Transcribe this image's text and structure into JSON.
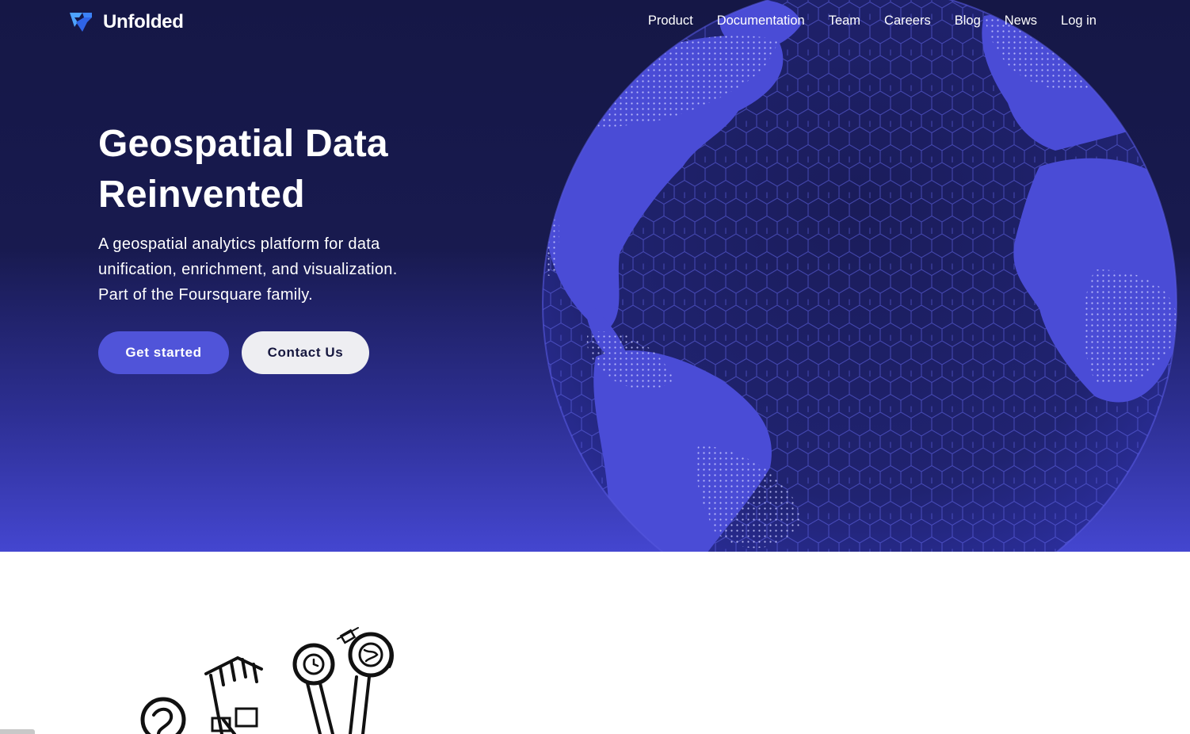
{
  "brand": {
    "name": "Unfolded",
    "logo_icon": "unfolded-logo-icon"
  },
  "nav": {
    "items": [
      {
        "label": "Product"
      },
      {
        "label": "Documentation"
      },
      {
        "label": "Team"
      },
      {
        "label": "Careers"
      },
      {
        "label": "Blog"
      },
      {
        "label": "News"
      },
      {
        "label": "Log in"
      }
    ]
  },
  "hero": {
    "title_line1": "Geospatial Data",
    "title_line2": "Reinvented",
    "subtitle_line1": "A geospatial analytics platform for data",
    "subtitle_line2": "unification, enrichment, and visualization.",
    "subtitle_line3": "Part of the Foursquare family.",
    "primary_button": "Get started",
    "secondary_button": "Contact Us",
    "globe_icon": "hex-grid-globe"
  },
  "colors": {
    "hero_top": "#151746",
    "hero_bottom": "#4446d0",
    "accent": "#5054d9",
    "globe_land": "#4a4cd6",
    "secondary_button_bg": "#eeeef2"
  }
}
